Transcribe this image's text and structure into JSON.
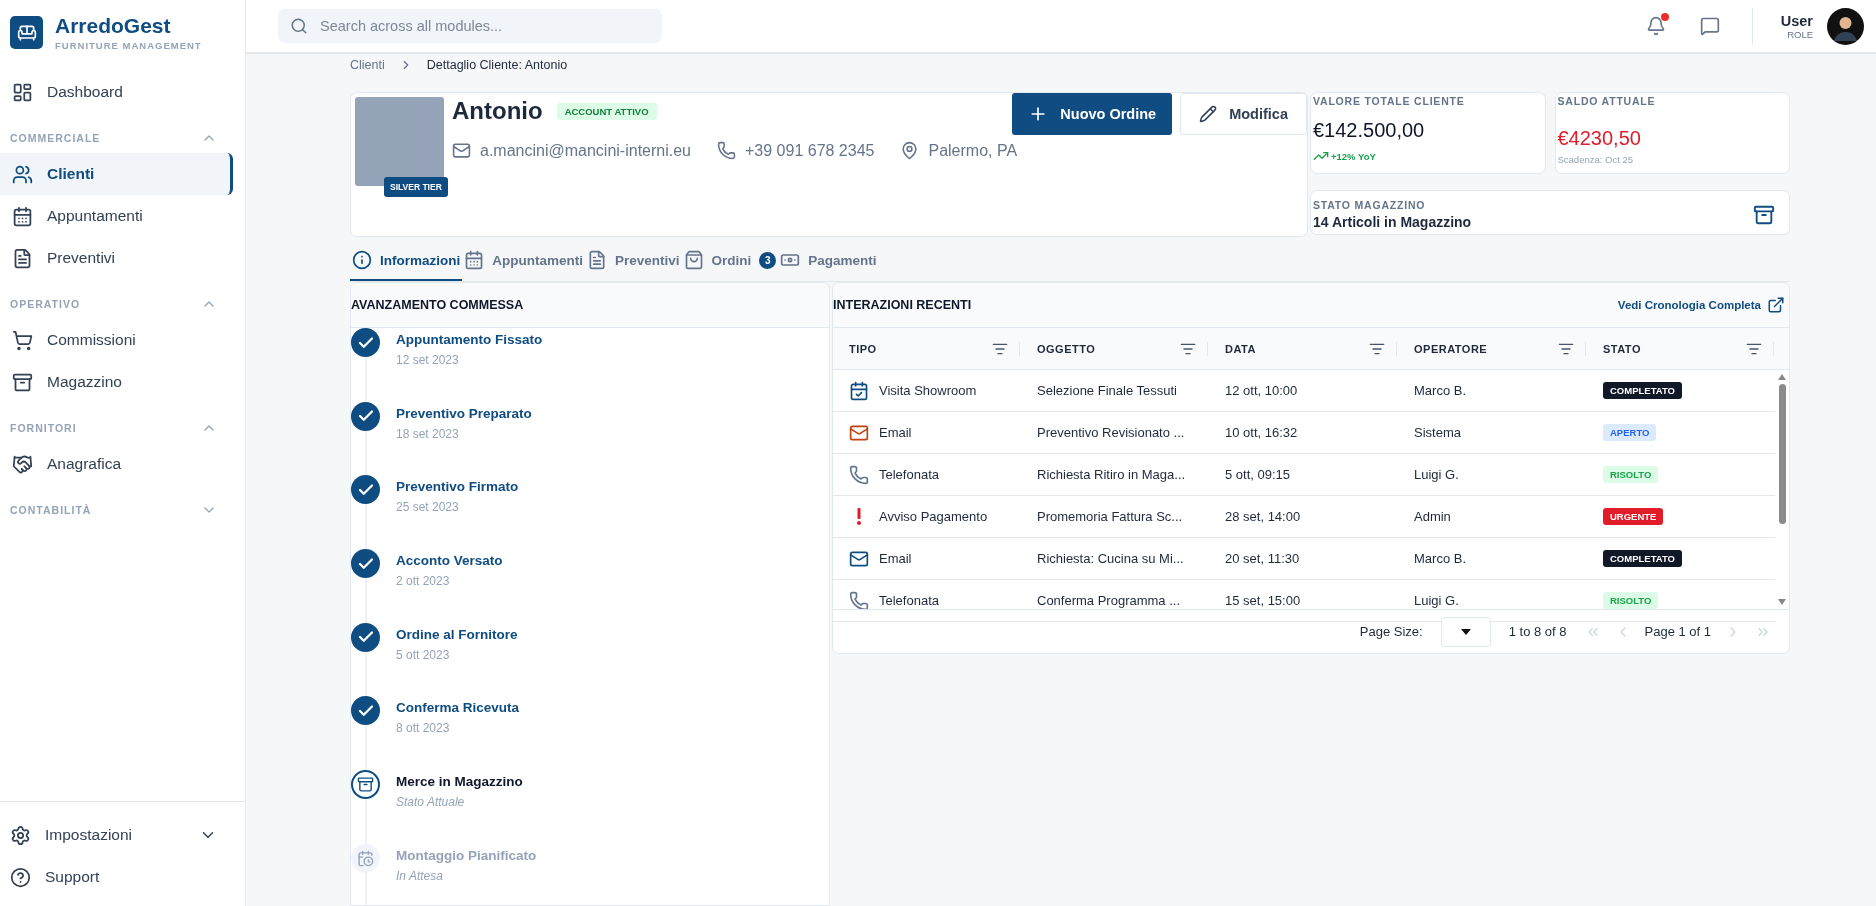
{
  "brand": {
    "name": "ArredoGest",
    "tagline": "FURNITURE MANAGEMENT"
  },
  "sidebar": {
    "top": [
      {
        "label": "Dashboard",
        "selected": false
      }
    ],
    "sections": [
      {
        "title": "COMMERCIALE",
        "expanded": true,
        "items": [
          {
            "label": "Clienti",
            "selected": true
          },
          {
            "label": "Appuntamenti",
            "selected": false
          },
          {
            "label": "Preventivi",
            "selected": false
          }
        ]
      },
      {
        "title": "OPERATIVO",
        "expanded": true,
        "items": [
          {
            "label": "Commissioni",
            "selected": false
          },
          {
            "label": "Magazzino",
            "selected": false
          }
        ]
      },
      {
        "title": "FORNITORI",
        "expanded": true,
        "items": [
          {
            "label": "Anagrafica",
            "selected": false
          }
        ]
      },
      {
        "title": "CONTABILITÀ",
        "expanded": false
      }
    ],
    "bottom": [
      {
        "label": "Impostazioni",
        "expanded": false
      },
      {
        "label": "Support"
      }
    ]
  },
  "topbar": {
    "search": {
      "placeholder": "Search across all modules..."
    },
    "notifications_unread": true,
    "user": {
      "name": "User",
      "role": "ROLE"
    }
  },
  "breadcrumb": [
    "Clienti",
    "Dettaglio Cliente: Antonio"
  ],
  "customer": {
    "name": "Antonio",
    "status": "ACCOUNT ATTIVO",
    "tier": "SILVER TIER",
    "email": "a.mancini@mancini-interni.eu",
    "phone": "+39 091 678 2345",
    "location": "Palermo, PA",
    "actions": [
      "Nuovo Ordine",
      "Modifica"
    ]
  },
  "stats": {
    "total": {
      "label": "VALORE TOTALE CLIENTE",
      "value": "€142.500,00",
      "trend": "+12% YoY"
    },
    "balance": {
      "label": "SALDO ATTUALE",
      "value": "€4230,50",
      "note": "Scadenza: Oct 25"
    },
    "stock": {
      "label": "STATO MAGAZZINO",
      "value": "14 Articoli in Magazzino"
    }
  },
  "tabs": [
    {
      "label": "Informazioni",
      "selected": true
    },
    {
      "label": "Appuntamenti",
      "selected": false
    },
    {
      "label": "Preventivi",
      "selected": false
    },
    {
      "label": "Ordini",
      "selected": false,
      "badge": "3"
    },
    {
      "label": "Pagamenti",
      "selected": false
    }
  ],
  "progress": {
    "title": "AVANZAMENTO COMMESSA",
    "steps": [
      {
        "kind": "done",
        "title": "Appuntamento Fissato",
        "sub": "12 set 2023"
      },
      {
        "kind": "done",
        "title": "Preventivo Preparato",
        "sub": "18 set 2023"
      },
      {
        "kind": "done",
        "title": "Preventivo Firmato",
        "sub": "25 set 2023"
      },
      {
        "kind": "done",
        "title": "Acconto Versato",
        "sub": "2 ott 2023"
      },
      {
        "kind": "done",
        "title": "Ordine al Fornitore",
        "sub": "5 ott 2023"
      },
      {
        "kind": "done",
        "title": "Conferma Ricevuta",
        "sub": "8 ott 2023"
      },
      {
        "kind": "current",
        "title": "Merce in Magazzino",
        "sub": "Stato Attuale"
      },
      {
        "kind": "pending",
        "title": "Montaggio Pianificato",
        "sub": "In Attesa"
      }
    ]
  },
  "interactions": {
    "title": "INTERAZIONI RECENTI",
    "link": "Vedi Cronologia Completa",
    "columns": [
      "TIPO",
      "OGGETTO",
      "DATA",
      "OPERATORE",
      "STATO"
    ],
    "rows": [
      {
        "kind": "appointment",
        "color": "#0f4c81",
        "type": "Visita Showroom",
        "subject": "Selezione Finale Tessuti",
        "date": "12 ott, 10:00",
        "operator": "Marco B.",
        "status": {
          "label": "COMPLETATO",
          "kind": "done"
        }
      },
      {
        "kind": "email",
        "color": "#c2410c",
        "type": "Email",
        "subject": "Preventivo Revisionato ...",
        "date": "10 ott, 16:32",
        "operator": "Sistema",
        "status": {
          "label": "APERTO",
          "kind": "open"
        }
      },
      {
        "kind": "phone",
        "color": "#64748b",
        "type": "Telefonata",
        "subject": "Richiesta Ritiro in Maga...",
        "date": "5 ott, 09:15",
        "operator": "Luigi G.",
        "status": {
          "label": "RISOLTO",
          "kind": "resolved"
        }
      },
      {
        "kind": "alert",
        "color": "#e11d2a",
        "type": "Avviso Pagamento",
        "subject": "Promemoria Fattura Sc...",
        "date": "28 set, 14:00",
        "operator": "Admin",
        "status": {
          "label": "URGENTE",
          "kind": "urgent"
        }
      },
      {
        "kind": "email",
        "color": "#0f4c81",
        "type": "Email",
        "subject": "Richiesta: Cucina su Mi...",
        "date": "20 set, 11:30",
        "operator": "Marco B.",
        "status": {
          "label": "COMPLETATO",
          "kind": "done"
        }
      },
      {
        "kind": "phone",
        "color": "#64748b",
        "type": "Telefonata",
        "subject": "Conferma Programma ...",
        "date": "15 set, 15:00",
        "operator": "Luigi G.",
        "status": {
          "label": "RISOLTO",
          "kind": "resolved"
        }
      }
    ],
    "footer": {
      "page_size_label": "Page Size:",
      "range": "1 to 8 of 8",
      "page": "Page 1 of 1"
    }
  }
}
